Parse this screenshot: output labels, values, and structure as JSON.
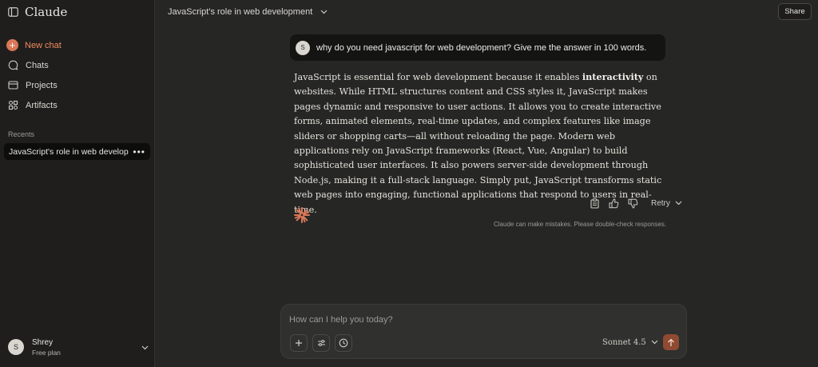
{
  "sidebar": {
    "brand": "Claude",
    "nav": [
      {
        "label": "New chat",
        "icon": "plus-icon"
      },
      {
        "label": "Chats",
        "icon": "chat-icon"
      },
      {
        "label": "Projects",
        "icon": "folder-icon"
      },
      {
        "label": "Artifacts",
        "icon": "artifacts-icon"
      }
    ],
    "recents_label": "Recents",
    "recents": [
      {
        "label": "JavaScript's role in web development"
      }
    ],
    "user": {
      "initial": "S",
      "name": "Shrey",
      "plan": "Free plan"
    }
  },
  "header": {
    "chat_title": "JavaScript's role in web development",
    "share_label": "Share"
  },
  "conversation": {
    "user_initial": "S",
    "user_message": "why do you need javascript for web development? Give me the answer in 100 words.",
    "response": {
      "before_bold": "JavaScript is essential for web development because it enables ",
      "bold": "interactivity",
      "after_bold": " on websites. While HTML structures content and CSS styles it, JavaScript makes pages dynamic and responsive to user actions. It allows you to create interactive forms, animated elements, real-time updates, and complex features like image sliders or shopping carts—all without reloading the page. Modern web applications rely on JavaScript frameworks (React, Vue, Angular) to build sophisticated user interfaces. It also powers server-side development through Node.js, making it a full-stack language. Simply put, JavaScript transforms static web pages into engaging, functional applications that respond to users in real-time."
    },
    "retry_label": "Retry",
    "disclaimer": "Claude can make mistakes. Please double-check responses."
  },
  "composer": {
    "placeholder": "How can I help you today?",
    "model": "Sonnet 4.5"
  },
  "colors": {
    "accent": "#d97757",
    "background": "#262624",
    "sidebar": "#1f1e1d",
    "send_button": "#8f4a32"
  }
}
